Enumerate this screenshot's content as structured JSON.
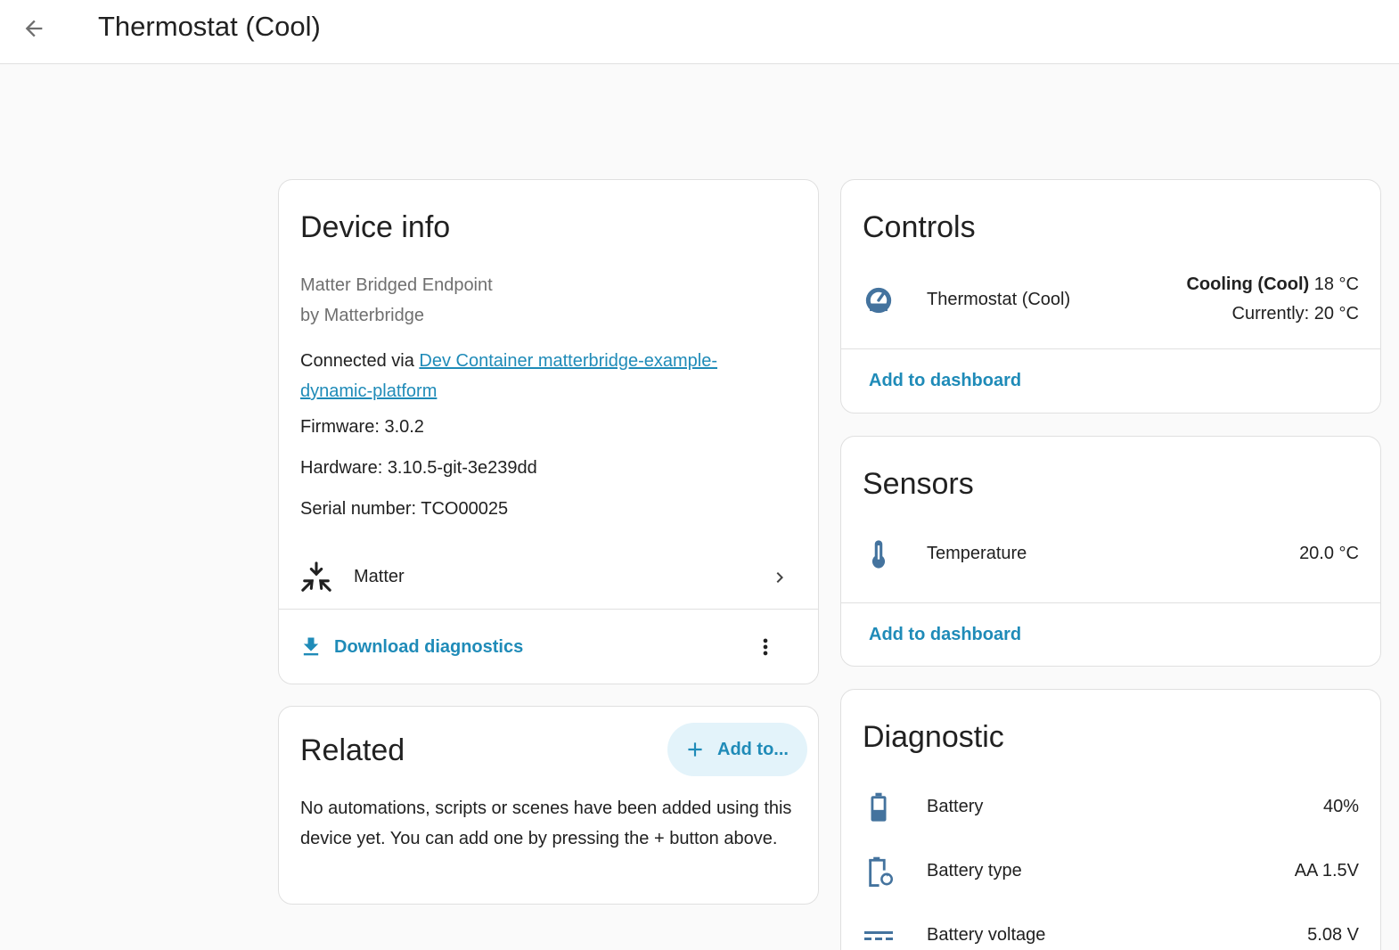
{
  "header": {
    "title": "Thermostat (Cool)",
    "back_icon": "arrow-left-icon"
  },
  "device_info": {
    "title": "Device info",
    "model": "Matter Bridged Endpoint",
    "manufacturer": "by Matterbridge",
    "connected_prefix": "Connected via ",
    "connected_link_line1": "Dev Container matterbridge-example-",
    "connected_link_line2": "dynamic-platform",
    "firmware": "Firmware: 3.0.2",
    "hardware": "Hardware: 3.10.5-git-3e239dd",
    "serial": "Serial number: TCO00025",
    "integration": {
      "label": "Matter",
      "icon": "matter-icon"
    },
    "download_label": "Download diagnostics"
  },
  "related": {
    "title": "Related",
    "add_label": "Add to...",
    "empty_text": "No automations, scripts or scenes have been added using this device yet. You can add one by pressing the + button above."
  },
  "controls": {
    "title": "Controls",
    "entity_name": "Thermostat (Cool)",
    "state_bold": "Cooling (Cool)",
    "state_temp": " 18 °C",
    "current": "Currently: 20 °C",
    "add_label": "Add to dashboard"
  },
  "sensors": {
    "title": "Sensors",
    "entity_name": "Temperature",
    "value": "20.0 °C",
    "add_label": "Add to dashboard"
  },
  "diagnostic": {
    "title": "Diagnostic",
    "rows": [
      {
        "name": "Battery",
        "value": "40%",
        "icon": "battery-icon"
      },
      {
        "name": "Battery type",
        "value": "AA 1.5V",
        "icon": "battery-sync-icon"
      },
      {
        "name": "Battery voltage",
        "value": "5.08 V",
        "icon": "voltage-dc-icon"
      }
    ]
  },
  "colors": {
    "accent": "#1f8bb8",
    "icon_blue": "#44739e",
    "pill_bg": "#e3f3fa"
  }
}
